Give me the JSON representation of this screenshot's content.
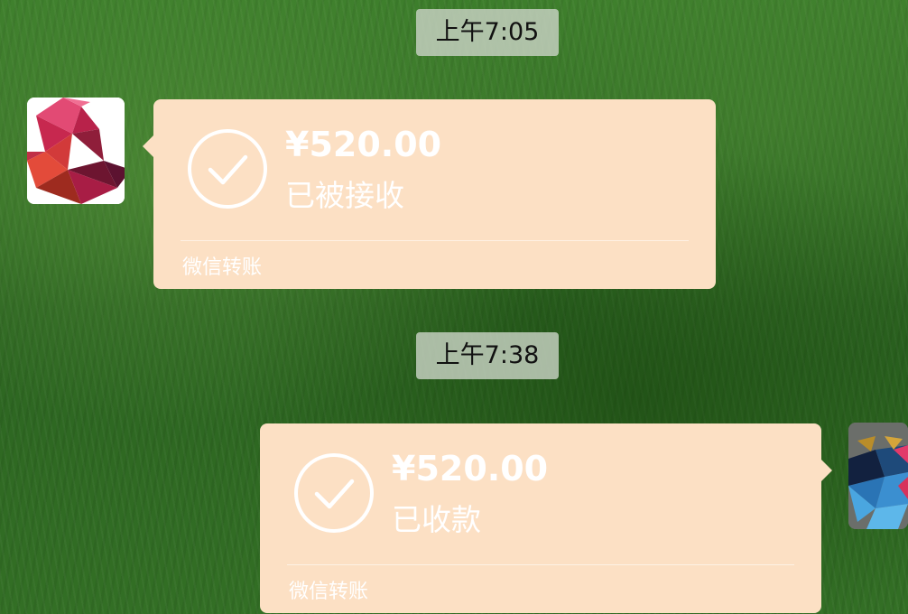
{
  "chat": {
    "messages": [
      {
        "time": "上午7:05",
        "transfer": {
          "amount": "¥520.00",
          "status": "已被接收",
          "footer": "微信转账"
        }
      },
      {
        "time": "上午7:38",
        "transfer": {
          "amount": "¥520.00",
          "status": "已收款",
          "footer": "微信转账"
        }
      }
    ]
  },
  "icons": {
    "transfer_status": "check-circle-icon"
  },
  "colors": {
    "card_background": "#fce0c4",
    "card_text": "#ffffff",
    "timestamp_background": "#c8d2c3",
    "chat_background": "#2f6b21"
  }
}
